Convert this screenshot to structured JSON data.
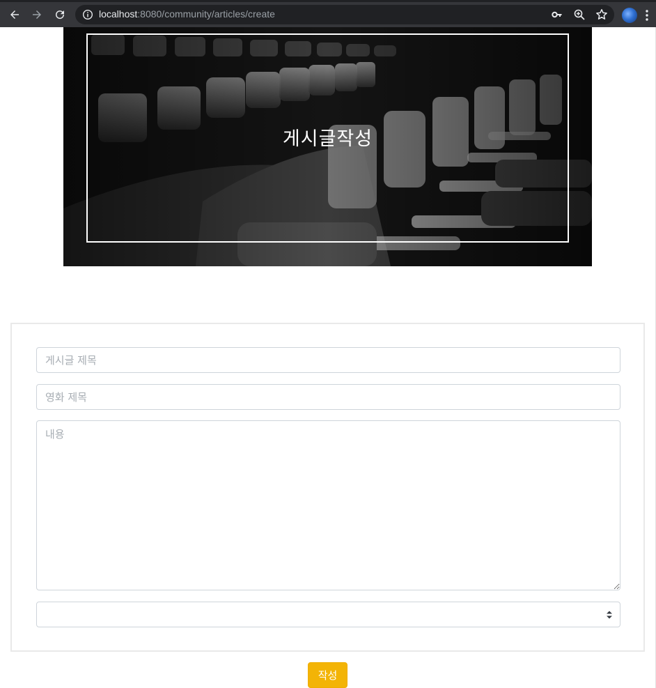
{
  "browser": {
    "url_host": "localhost",
    "url_rest": ":8080/community/articles/create"
  },
  "hero": {
    "title": "게시글작성"
  },
  "form": {
    "title_placeholder": "게시글 제목",
    "movie_placeholder": "영화 제목",
    "content_placeholder": "내용",
    "select_value": "",
    "submit_label": "작성"
  },
  "colors": {
    "submit_bg": "#f3b406",
    "chrome_bg": "#35363a",
    "omnibox_bg": "#202124"
  }
}
